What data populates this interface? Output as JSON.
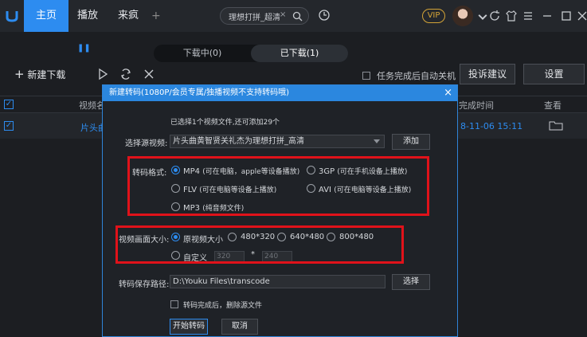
{
  "topbar": {
    "tabs": [
      {
        "label": "主页"
      },
      {
        "label": "播放"
      },
      {
        "label": "来疯"
      },
      {
        "label": "+"
      }
    ],
    "search_value": "理想打拼_超清",
    "vip": "VIP"
  },
  "subtabs": {
    "downloading": "下载中(0)",
    "downloaded": "已下载(1)"
  },
  "toolbar": {
    "new_download": "新建下载",
    "auto_shutdown": "任务完成后自动关机",
    "feedback": "投诉建议",
    "settings": "设置"
  },
  "table": {
    "headers": {
      "video_name": "视频名",
      "finish_time": "完成时间",
      "view": "查看"
    },
    "rows": [
      {
        "name": "片头曲",
        "time": "8-11-06 15:11"
      }
    ]
  },
  "dialog": {
    "title": "新建转码(1080P/会员专属/独播视频不支持转码哦)",
    "selected_info": "已选择1个视频文件,还可添加29个",
    "source_label": "选择源视频:",
    "source_value": "片头曲黄智贤关礼杰为理想打拼_高清",
    "add_btn": "添加",
    "format_label": "转码格式:",
    "formats": [
      {
        "name": "MP4",
        "desc": "(可在电脑，apple等设备播放)",
        "selected": true
      },
      {
        "name": "3GP",
        "desc": "(可在手机设备上播放)",
        "selected": false
      },
      {
        "name": "FLV",
        "desc": "(可在电脑等设备上播放)",
        "selected": false
      },
      {
        "name": "AVI",
        "desc": "(可在电脑等设备上播放)",
        "selected": false
      },
      {
        "name": "MP3",
        "desc": "(纯音频文件)",
        "selected": false
      }
    ],
    "size_label": "视频画面大小:",
    "sizes": [
      {
        "name": "原视频大小",
        "selected": true
      },
      {
        "name": "480*320",
        "selected": false
      },
      {
        "name": "640*480",
        "selected": false
      },
      {
        "name": "800*480",
        "selected": false
      },
      {
        "name": "自定义",
        "selected": false
      }
    ],
    "custom_w": "320",
    "custom_sep": "*",
    "custom_h": "240",
    "path_label": "转码保存路径:",
    "path_value": "D:\\Youku Files\\transcode",
    "browse_btn": "选择",
    "delete_src": "转码完成后，删除源文件",
    "start_btn": "开始转码",
    "cancel_btn": "取消",
    "close": "×"
  },
  "colors": {
    "accent": "#2d8cf0",
    "highlight": "#e0121a"
  }
}
